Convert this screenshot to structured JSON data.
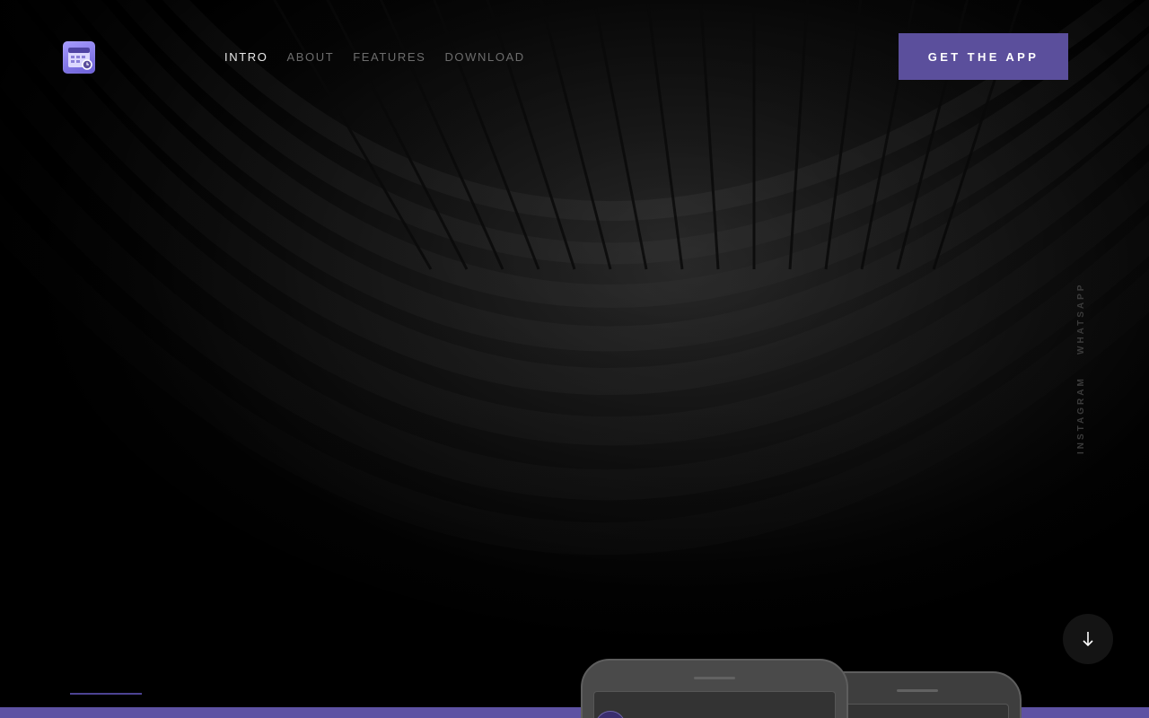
{
  "brand": {
    "logo_icon": "calendar-app-icon",
    "accent_color": "#5b4f9c",
    "band_color": "#5e52a3"
  },
  "nav": {
    "items": [
      {
        "label": "INTRO",
        "active": true
      },
      {
        "label": "ABOUT",
        "active": false
      },
      {
        "label": "FEATURES",
        "active": false
      },
      {
        "label": "DOWNLOAD",
        "active": false
      }
    ]
  },
  "header": {
    "cta_label": "GET THE APP"
  },
  "social": {
    "links": [
      {
        "label": "WHATSAPP"
      },
      {
        "label": "INSTAGRAM"
      }
    ]
  },
  "hero": {
    "scroll_icon": "arrow-down-icon",
    "background_icon": "architectural-lattice-image",
    "mockup_icons": [
      "phone-mockup-front",
      "phone-mockup-back"
    ]
  }
}
